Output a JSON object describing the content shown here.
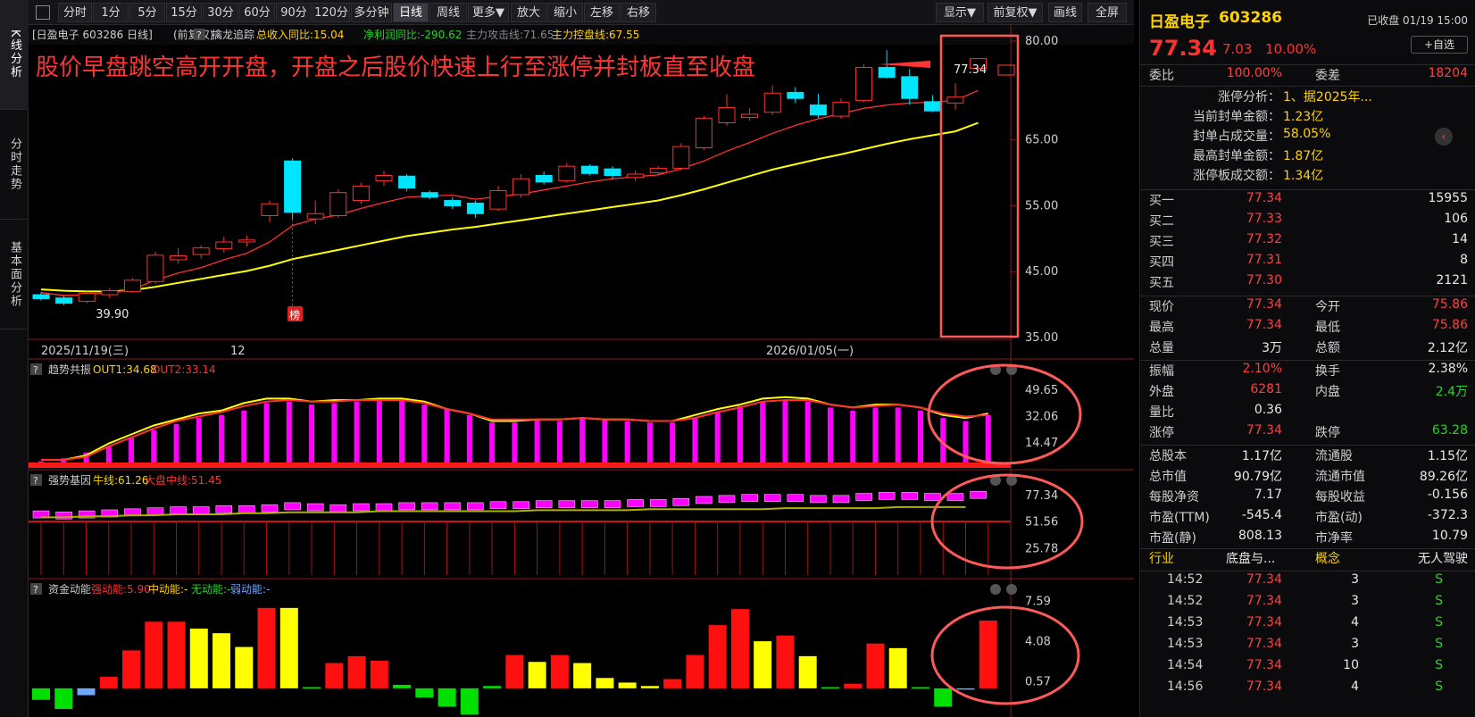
{
  "sidebar": {
    "tabs": [
      {
        "label": "K线分析",
        "active": true
      },
      {
        "label": "分时走势",
        "active": false
      },
      {
        "label": "基本面分析",
        "active": false
      }
    ]
  },
  "toolbar": {
    "periods": [
      "分时",
      "1分",
      "5分",
      "15分",
      "30分",
      "60分",
      "90分",
      "120分",
      "多分钟",
      "日线",
      "周线",
      "更多▼"
    ],
    "active_period": "日线",
    "zoom": [
      "放大",
      "缩小",
      "左移",
      "右移"
    ],
    "right": [
      "显示▼",
      "前复权▼",
      "画线",
      "全屏"
    ]
  },
  "header": {
    "stock_tag": "[日盈电子 603286 日线]",
    "adjust": "(前复权)",
    "help": "?",
    "indicator_name": "擒龙追踪",
    "revenue_yoy": "总收入同比:15.04",
    "profit_yoy": "净利润同比:-290.62",
    "attack_line": "主力攻击线:71.65",
    "control_line": "主力控盘线:67.55"
  },
  "annotation": {
    "text": "股价早盘跳空高开开盘，开盘之后股价快速上行至涨停并封板直至收盘"
  },
  "main_chart": {
    "low_label": "39.90",
    "high_label": "77.34",
    "bang_label": "榜",
    "yticks": [
      "80.00",
      "65.00",
      "55.00",
      "45.00",
      "35.00"
    ],
    "date_labels": [
      "2025/11/19(三)",
      "12",
      "2026/01/05(一)"
    ]
  },
  "panels": [
    {
      "title": "趋势共振",
      "help": "?",
      "l1": "OUT1:34.68",
      "l2": "OUT2:33.14",
      "yticks": [
        "49.65",
        "32.06",
        "14.47"
      ]
    },
    {
      "title": "强势基因",
      "help": "?",
      "l1": "牛线:61.26",
      "l2": "大盘中线:51.45",
      "yticks": [
        "77.34",
        "51.56",
        "25.78"
      ]
    },
    {
      "title": "资金动能",
      "help": "?",
      "l1": "强动能:5.90",
      "l2": "中动能:-",
      "l3": "无动能:-",
      "l4": "弱动能:-",
      "yticks": [
        "7.59",
        "4.08",
        "0.57"
      ]
    }
  ],
  "colors": {
    "up": "#ff3030",
    "down": "#00e5ff",
    "ma_yellow": "#ffff00",
    "magenta": "#ff00ff",
    "annotation": "#ff3535",
    "highlight": "#ff5a5a"
  },
  "chart_data": {
    "type": "candlestick",
    "ylim": [
      35,
      80
    ],
    "candles": [
      {
        "o": 41.5,
        "h": 41.9,
        "l": 40.6,
        "c": 40.9
      },
      {
        "o": 41.0,
        "h": 41.4,
        "l": 39.9,
        "c": 40.2
      },
      {
        "o": 40.5,
        "h": 42.0,
        "l": 40.2,
        "c": 41.7
      },
      {
        "o": 41.5,
        "h": 42.5,
        "l": 41.0,
        "c": 42.1
      },
      {
        "o": 42.0,
        "h": 44.0,
        "l": 41.8,
        "c": 43.7
      },
      {
        "o": 43.5,
        "h": 48.0,
        "l": 43.2,
        "c": 47.5
      },
      {
        "o": 46.8,
        "h": 48.6,
        "l": 46.2,
        "c": 47.4
      },
      {
        "o": 47.6,
        "h": 49.0,
        "l": 47.0,
        "c": 48.6
      },
      {
        "o": 48.5,
        "h": 50.3,
        "l": 47.9,
        "c": 49.5
      },
      {
        "o": 49.5,
        "h": 50.5,
        "l": 48.8,
        "c": 49.8
      },
      {
        "o": 53.5,
        "h": 55.8,
        "l": 52.5,
        "c": 55.3
      },
      {
        "o": 61.8,
        "h": 62.2,
        "l": 53.0,
        "c": 54.0
      },
      {
        "o": 53.0,
        "h": 55.8,
        "l": 52.2,
        "c": 53.8
      },
      {
        "o": 53.5,
        "h": 57.5,
        "l": 53.2,
        "c": 57.0
      },
      {
        "o": 55.8,
        "h": 58.5,
        "l": 55.3,
        "c": 58.0
      },
      {
        "o": 58.8,
        "h": 60.3,
        "l": 58.0,
        "c": 59.6
      },
      {
        "o": 59.5,
        "h": 59.8,
        "l": 57.2,
        "c": 57.7
      },
      {
        "o": 57.0,
        "h": 57.3,
        "l": 56.0,
        "c": 56.3
      },
      {
        "o": 55.8,
        "h": 56.3,
        "l": 54.5,
        "c": 55.0
      },
      {
        "o": 55.4,
        "h": 55.8,
        "l": 53.2,
        "c": 53.8
      },
      {
        "o": 54.5,
        "h": 58.0,
        "l": 54.2,
        "c": 57.3
      },
      {
        "o": 56.7,
        "h": 59.8,
        "l": 56.2,
        "c": 59.1
      },
      {
        "o": 59.6,
        "h": 60.2,
        "l": 58.2,
        "c": 58.6
      },
      {
        "o": 58.8,
        "h": 61.5,
        "l": 58.5,
        "c": 61.0
      },
      {
        "o": 61.0,
        "h": 61.3,
        "l": 59.6,
        "c": 59.9
      },
      {
        "o": 60.6,
        "h": 61.0,
        "l": 59.0,
        "c": 59.6
      },
      {
        "o": 59.3,
        "h": 60.3,
        "l": 58.8,
        "c": 59.8
      },
      {
        "o": 60.0,
        "h": 61.0,
        "l": 59.6,
        "c": 60.7
      },
      {
        "o": 60.7,
        "h": 64.5,
        "l": 60.4,
        "c": 64.0
      },
      {
        "o": 63.8,
        "h": 68.6,
        "l": 63.5,
        "c": 68.3
      },
      {
        "o": 67.6,
        "h": 71.9,
        "l": 67.2,
        "c": 69.9
      },
      {
        "o": 68.4,
        "h": 69.8,
        "l": 67.9,
        "c": 68.9
      },
      {
        "o": 69.2,
        "h": 73.3,
        "l": 68.8,
        "c": 72.1
      },
      {
        "o": 72.2,
        "h": 73.0,
        "l": 70.6,
        "c": 71.3
      },
      {
        "o": 70.3,
        "h": 72.0,
        "l": 68.3,
        "c": 68.8
      },
      {
        "o": 68.6,
        "h": 71.3,
        "l": 68.2,
        "c": 70.7
      },
      {
        "o": 71.0,
        "h": 76.5,
        "l": 70.7,
        "c": 76.0
      },
      {
        "o": 76.0,
        "h": 78.6,
        "l": 74.3,
        "c": 74.5
      },
      {
        "o": 74.6,
        "h": 75.8,
        "l": 70.3,
        "c": 71.3
      },
      {
        "o": 70.8,
        "h": 71.8,
        "l": 69.2,
        "c": 69.4
      },
      {
        "o": 70.6,
        "h": 73.6,
        "l": 69.6,
        "c": 71.5
      },
      {
        "o": 75.86,
        "h": 77.34,
        "l": 75.86,
        "c": 77.34
      }
    ],
    "ma_short": [
      41.8,
      41.4,
      41.5,
      41.8,
      42.3,
      43.7,
      44.8,
      45.6,
      46.8,
      47.8,
      49.5,
      52.0,
      53.0,
      53.6,
      54.6,
      55.5,
      56.3,
      56.5,
      56.6,
      56.0,
      56.4,
      56.8,
      57.4,
      58.0,
      58.6,
      59.1,
      59.4,
      59.7,
      60.6,
      61.8,
      63.3,
      64.6,
      66.0,
      67.2,
      68.2,
      69.0,
      69.8,
      70.3,
      70.6,
      70.7,
      71.0,
      72.5
    ],
    "ma_long": [
      42.3,
      42.1,
      42.0,
      42.0,
      42.2,
      42.7,
      43.3,
      43.9,
      44.5,
      45.1,
      45.9,
      46.9,
      47.6,
      48.3,
      49.0,
      49.7,
      50.4,
      50.9,
      51.4,
      51.8,
      52.3,
      52.8,
      53.3,
      53.8,
      54.3,
      54.8,
      55.3,
      55.8,
      56.6,
      57.5,
      58.5,
      59.5,
      60.5,
      61.3,
      62.1,
      62.8,
      63.6,
      64.4,
      65.1,
      65.7,
      66.3,
      67.6
    ],
    "osc_bars": [
      2,
      4,
      8,
      12,
      18,
      23,
      27,
      31,
      33,
      36,
      41,
      42,
      40,
      41,
      42,
      43,
      43,
      40,
      37,
      33,
      28,
      28,
      30,
      29,
      31,
      30,
      29,
      28,
      28,
      31,
      35,
      39,
      42,
      43,
      42,
      38,
      36,
      38,
      38,
      36,
      31,
      29,
      33
    ],
    "osc_line1": [
      3,
      3,
      6,
      14,
      20,
      26,
      30,
      34,
      36,
      41,
      44,
      44,
      42,
      43,
      43,
      44,
      44,
      42,
      37,
      34,
      29,
      29,
      30,
      30,
      31,
      30,
      30,
      29,
      29,
      33,
      37,
      40,
      44,
      45,
      44,
      40,
      38,
      40,
      40,
      38,
      33,
      31,
      34
    ],
    "osc_line2": [
      3,
      3,
      5,
      12,
      18,
      24,
      29,
      32,
      35,
      39,
      42,
      43,
      42,
      42,
      43,
      43,
      43,
      41,
      37,
      34,
      30,
      30,
      30,
      30,
      31,
      30,
      30,
      29,
      29,
      31,
      35,
      38,
      42,
      43,
      43,
      40,
      38,
      39,
      40,
      38,
      34,
      32,
      33
    ],
    "osc_ylim": [
      0,
      55
    ],
    "strength_boxes": [
      58,
      57,
      58,
      59,
      60,
      61,
      62,
      62,
      63,
      63,
      64,
      66,
      65,
      64,
      65,
      65,
      66,
      66,
      66,
      66,
      67,
      67,
      68,
      68,
      68,
      68,
      69,
      69,
      70,
      72,
      73,
      74,
      74,
      74,
      73,
      73,
      75,
      76,
      76,
      75,
      75,
      77
    ],
    "strength_line": [
      56,
      56,
      57,
      57,
      58,
      58,
      59,
      59,
      59,
      60,
      60,
      61,
      61,
      61,
      61,
      62,
      62,
      62,
      62,
      62,
      62,
      62,
      63,
      63,
      63,
      63,
      63,
      64,
      64,
      64,
      64,
      64,
      64,
      65,
      65,
      65,
      65,
      65,
      66,
      66,
      66,
      66
    ],
    "strength_ylim": [
      0,
      85
    ],
    "flow_bars": [
      -1.0,
      -1.8,
      -0.6,
      1.0,
      3.3,
      5.8,
      5.8,
      5.2,
      4.8,
      3.6,
      7.0,
      7.0,
      0.1,
      2.2,
      2.8,
      2.4,
      0.3,
      -0.8,
      -1.6,
      -2.3,
      0.2,
      2.9,
      2.3,
      2.9,
      2.2,
      0.9,
      0.5,
      0.2,
      0.8,
      2.9,
      5.5,
      6.9,
      4.1,
      4.6,
      2.8,
      0.1,
      0.4,
      3.9,
      3.5,
      0.1,
      -1.6,
      -0.1,
      5.9
    ],
    "flow_ylim": [
      -2.5,
      8.0
    ]
  },
  "quote": {
    "name": "日盈电子",
    "code": "603286",
    "status": "已收盘 01/19 15:00",
    "fav": "+自选",
    "price": "77.34",
    "change": "7.03",
    "pct": "10.00%",
    "wb_label": "委比",
    "wb_val": "100.00%",
    "wc_label": "委差",
    "wc_val": "18204",
    "limit_analysis": [
      {
        "k": "涨停分析：",
        "v": "1、据2025年..."
      },
      {
        "k": "当前封单金额：",
        "v": "1.23亿"
      },
      {
        "k": "封单占成交量：",
        "v": "58.05%"
      },
      {
        "k": "最高封单金额：",
        "v": "1.87亿"
      },
      {
        "k": "涨停板成交额：",
        "v": "1.34亿"
      }
    ],
    "bids": [
      {
        "k": "买一",
        "p": "77.34",
        "v": "15955"
      },
      {
        "k": "买二",
        "p": "77.33",
        "v": "106"
      },
      {
        "k": "买三",
        "p": "77.32",
        "v": "14"
      },
      {
        "k": "买四",
        "p": "77.31",
        "v": "8"
      },
      {
        "k": "买五",
        "p": "77.30",
        "v": "2121"
      }
    ],
    "stats": [
      {
        "k1": "现价",
        "v1": "77.34",
        "c1": "red",
        "k2": "今开",
        "v2": "75.86",
        "c2": "red"
      },
      {
        "k1": "最高",
        "v1": "77.34",
        "c1": "red",
        "k2": "最低",
        "v2": "75.86",
        "c2": "red"
      },
      {
        "k1": "总量",
        "v1": "3万",
        "c1": "white",
        "k2": "总额",
        "v2": "2.12亿",
        "c2": "white"
      },
      {
        "k1": "振幅",
        "v1": "2.10%",
        "c1": "red",
        "k2": "换手",
        "v2": "2.38%",
        "c2": "white"
      },
      {
        "k1": "外盘",
        "v1": "6281",
        "c1": "red",
        "k2": "内盘",
        "v2": "2.4万",
        "c2": "green"
      },
      {
        "k1": "量比",
        "v1": "0.36",
        "c1": "white",
        "k2": "",
        "v2": "",
        "c2": "white"
      },
      {
        "k1": "涨停",
        "v1": "77.34",
        "c1": "red",
        "k2": "跌停",
        "v2": "63.28",
        "c2": "green"
      },
      {
        "k1": "总股本",
        "v1": "1.17亿",
        "c1": "white",
        "k2": "流通股",
        "v2": "1.15亿",
        "c2": "white"
      },
      {
        "k1": "总市值",
        "v1": "90.79亿",
        "c1": "white",
        "k2": "流通市值",
        "v2": "89.26亿",
        "c2": "white"
      },
      {
        "k1": "每股净资",
        "v1": "7.17",
        "c1": "white",
        "k2": "每股收益",
        "v2": "-0.156",
        "c2": "white"
      },
      {
        "k1": "市盈(TTM)",
        "v1": "-545.4",
        "c1": "white",
        "k2": "市盈(动)",
        "v2": "-372.3",
        "c2": "white"
      },
      {
        "k1": "市盈(静)",
        "v1": "808.13",
        "c1": "white",
        "k2": "市净率",
        "v2": "10.79",
        "c2": "white"
      }
    ],
    "industry": {
      "k1": "行业",
      "v1": "底盘与...",
      "k2": "概念",
      "v2": "无人驾驶"
    },
    "ticks": [
      {
        "t": "14:52",
        "p": "77.34",
        "n": "3",
        "s": "S"
      },
      {
        "t": "14:52",
        "p": "77.34",
        "n": "3",
        "s": "S"
      },
      {
        "t": "14:53",
        "p": "77.34",
        "n": "4",
        "s": "S"
      },
      {
        "t": "14:53",
        "p": "77.34",
        "n": "3",
        "s": "S"
      },
      {
        "t": "14:54",
        "p": "77.34",
        "n": "10",
        "s": "S"
      },
      {
        "t": "14:56",
        "p": "77.34",
        "n": "4",
        "s": "S"
      }
    ]
  }
}
